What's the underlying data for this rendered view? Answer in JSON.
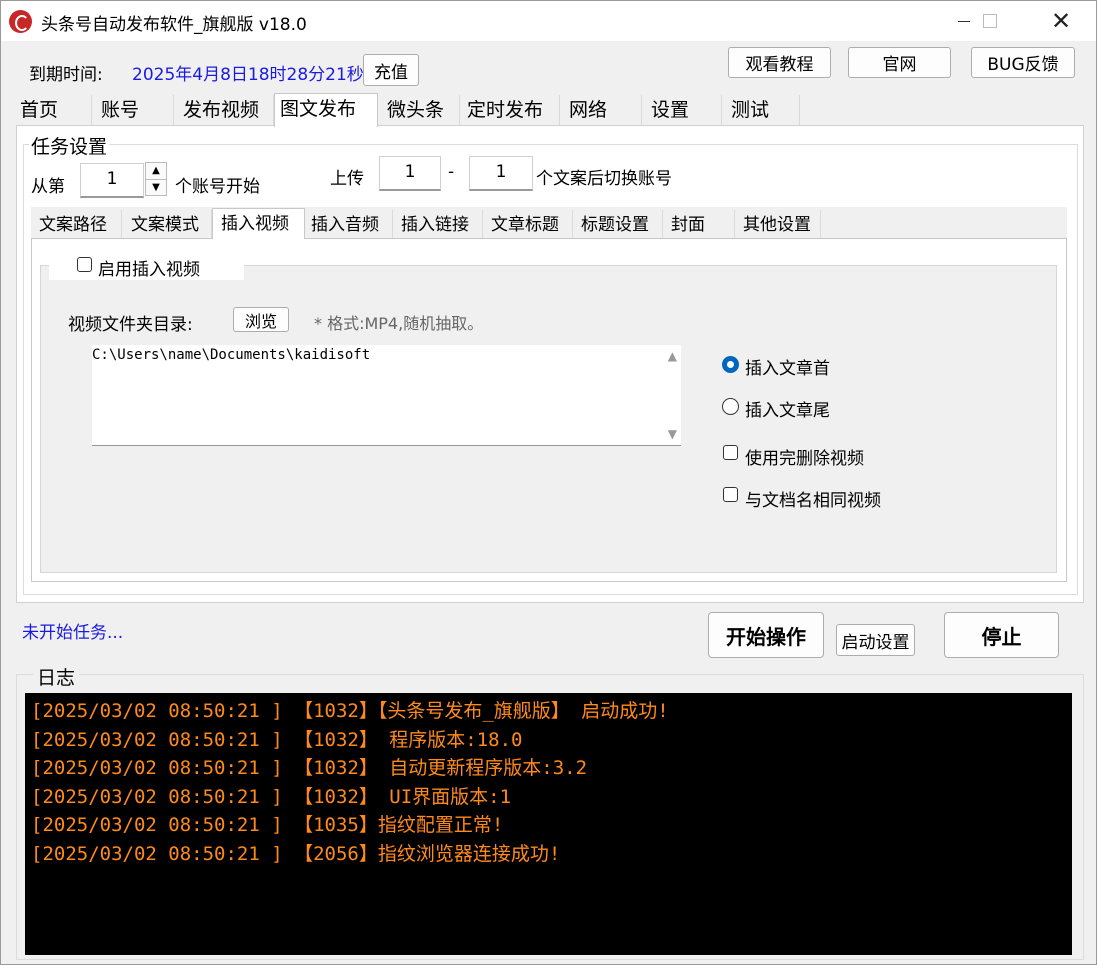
{
  "window": {
    "title": "头条号自动发布软件_旗舰版  v18.0",
    "controls": {
      "minimize": "—",
      "close": "✕"
    }
  },
  "header": {
    "expiry_label": "到期时间:",
    "expiry_value": "2025年4月8日18时28分21秒",
    "expiry_color": "#1a1ae0",
    "recharge_button": "充值",
    "tutorial_button": "观看教程",
    "website_button": "官网",
    "bug_button": "BUG反馈"
  },
  "tabs": [
    "首页",
    "账号",
    "发布视频",
    "图文发布",
    "微头条",
    "定时发布",
    "网络",
    "设置",
    "测试"
  ],
  "active_tab": "图文发布",
  "task_settings": {
    "title": "任务设置",
    "from_label": "从第",
    "from_value": "1",
    "start_account_label": "个账号开始",
    "upload_label": "上传",
    "range_start": "1",
    "range_dash": "-",
    "range_end": "1",
    "switch_label": "个文案后切换账号"
  },
  "subtabs": [
    "文案路径",
    "文案模式",
    "插入视频",
    "插入音频",
    "插入链接",
    "文章标题",
    "标题设置",
    "封面",
    "其他设置"
  ],
  "active_subtab": "插入视频",
  "insert_video": {
    "enable_label": "启用插入视频",
    "enable_checked": false,
    "folder_label": "视频文件夹目录:",
    "browse_button": "浏览",
    "format_hint": "* 格式:MP4,随机抽取。",
    "folder_path": "C:\\Users\\name\\Documents\\kaidisoft",
    "position_options": [
      {
        "label": "插入文章首",
        "selected": true
      },
      {
        "label": "插入文章尾",
        "selected": false
      }
    ],
    "delete_after_use_label": "使用完删除视频",
    "delete_after_use_checked": false,
    "same_name_label": "与文档名相同视频",
    "same_name_checked": false
  },
  "status": {
    "text": "未开始任务...",
    "color": "#1a1ae0"
  },
  "actions": {
    "start_button": "开始操作",
    "startup_settings_button": "启动设置",
    "stop_button": "停止"
  },
  "log": {
    "title": "日志",
    "text_color": "#ff8a1c",
    "lines": [
      "[2025/03/02 08:50:21 ] 【1032】【头条号发布_旗舰版】 启动成功!",
      "[2025/03/02 08:50:21 ] 【1032】 程序版本:18.0",
      "[2025/03/02 08:50:21 ] 【1032】 自动更新程序版本:3.2",
      "[2025/03/02 08:50:21 ] 【1032】 UI界面版本:1",
      "[2025/03/02 08:50:21 ] 【1035】指纹配置正常!",
      "[2025/03/02 08:50:21 ] 【2056】指纹浏览器连接成功!"
    ]
  }
}
